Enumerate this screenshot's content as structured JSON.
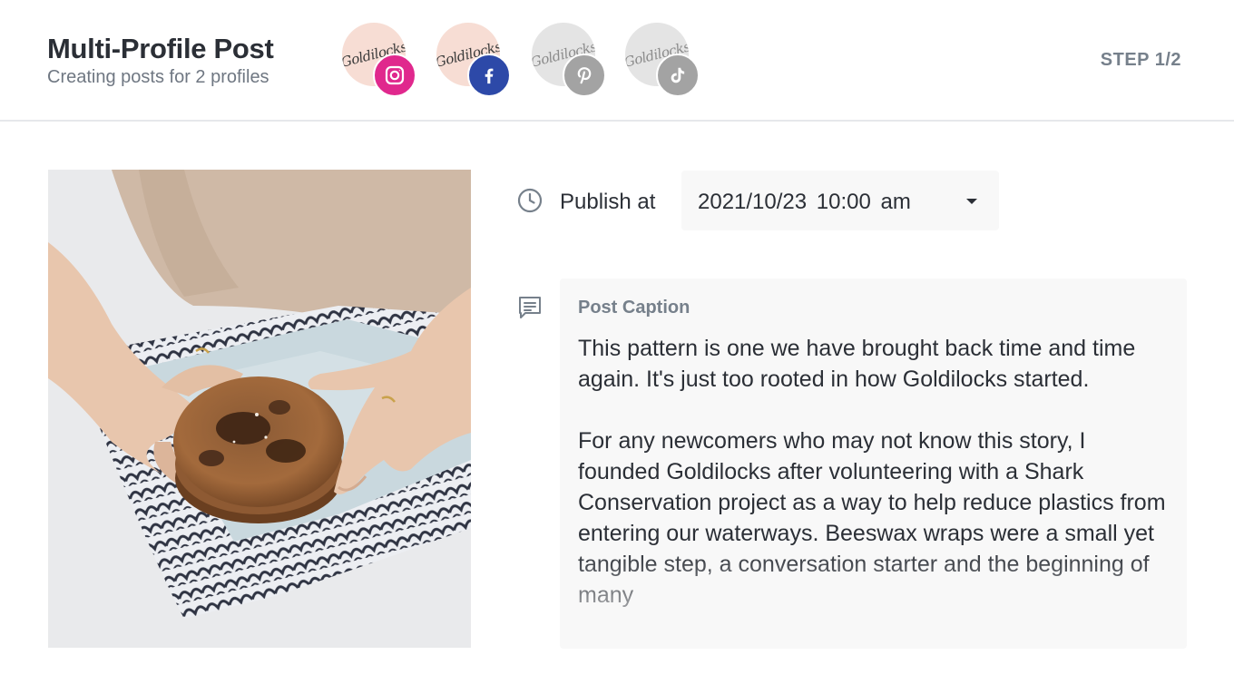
{
  "header": {
    "title": "Multi-Profile Post",
    "subtitle": "Creating posts for 2 profiles",
    "step": "STEP 1/2",
    "profiles": [
      {
        "avatar_text": "Goldilocks",
        "network": "instagram-icon",
        "badge_color": "#e0288d",
        "state": "selected"
      },
      {
        "avatar_text": "Goldilocks",
        "network": "facebook-icon",
        "badge_color": "#2d49a8",
        "state": "selected"
      },
      {
        "avatar_text": "Goldilocks",
        "network": "pinterest-icon",
        "badge_color": "#a3a3a3",
        "state": "unselected"
      },
      {
        "avatar_text": "Goldilocks",
        "network": "tiktok-icon",
        "badge_color": "#a3a3a3",
        "state": "unselected"
      }
    ]
  },
  "publish": {
    "label": "Publish at",
    "value": "2021/10/23 10:00 am"
  },
  "caption": {
    "label": "Post Caption",
    "paragraphs": [
      "This pattern is one we have brought back time and time again. It's just too rooted in how Goldilocks started.",
      "For any newcomers who may not know this story, I founded Goldilocks after volunteering with a Shark Conservation project as a way to help reduce plastics from entering our waterways. Beeswax wraps were a small yet tangible step, a conversation starter and the beginning of many"
    ]
  },
  "colors": {
    "title_text": "#2b2f36",
    "muted_text": "#76808b",
    "field_background": "#f8f8f8",
    "divider": "#e6e8eb"
  }
}
